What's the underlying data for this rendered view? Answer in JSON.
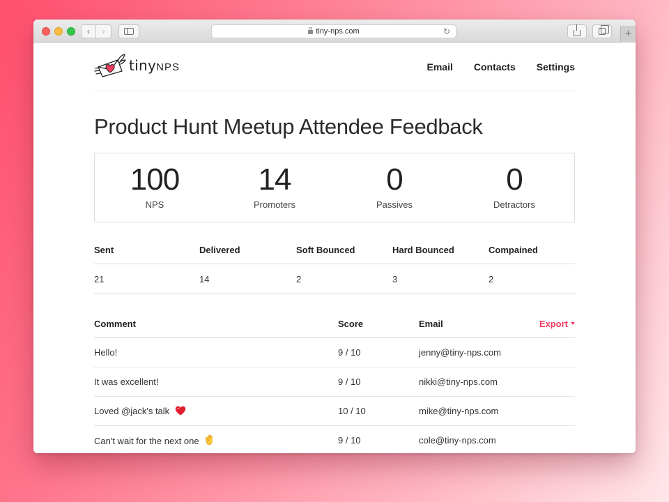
{
  "browser": {
    "url": "tiny-nps.com"
  },
  "app": {
    "logo_text_tiny": "tiny",
    "logo_text_nps": "NPS",
    "nav": [
      {
        "label": "Email"
      },
      {
        "label": "Contacts"
      },
      {
        "label": "Settings"
      }
    ]
  },
  "survey": {
    "title": "Product Hunt Meetup Attendee Feedback"
  },
  "stats": [
    {
      "value": "100",
      "label": "NPS"
    },
    {
      "value": "14",
      "label": "Promoters"
    },
    {
      "value": "0",
      "label": "Passives"
    },
    {
      "value": "0",
      "label": "Detractors"
    }
  ],
  "delivery": {
    "headers": [
      "Sent",
      "Delivered",
      "Soft Bounced",
      "Hard Bounced",
      "Compained"
    ],
    "values": [
      "21",
      "14",
      "2",
      "3",
      "2"
    ]
  },
  "comments": {
    "headers": {
      "comment": "Comment",
      "score": "Score",
      "email": "Email"
    },
    "export_label": "Export",
    "rows": [
      {
        "comment": "Hello!",
        "score": "9 / 10",
        "email": "jenny@tiny-nps.com"
      },
      {
        "comment": "It was excellent!",
        "score": "9 / 10",
        "email": "nikki@tiny-nps.com"
      },
      {
        "comment": "Loved @jack's talk",
        "score": "10 / 10",
        "email": "mike@tiny-nps.com"
      },
      {
        "comment": "Can't wait for the next one",
        "score": "9 / 10",
        "email": "cole@tiny-nps.com"
      }
    ]
  },
  "colors": {
    "accent": "#f03c5f",
    "text": "#222222",
    "border": "#dcdcdc"
  },
  "icons": {
    "logo": "winged-heart-envelope-icon",
    "row3_emoji": "red-heart-icon",
    "row4_emoji": "ok-hand-icon"
  }
}
